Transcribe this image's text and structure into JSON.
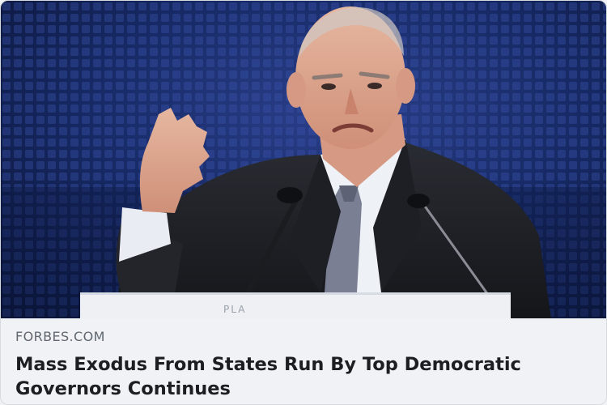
{
  "link_preview": {
    "domain": "FORBES.COM",
    "headline": "Mass Exodus From States Run By Top Democratic Governors Continues",
    "image_description_icon": "speaker-photo",
    "podium_text": "PLA"
  },
  "colors": {
    "footer_bg": "#f0f2f5",
    "domain_text": "#606770",
    "headline_text": "#1c1e21",
    "stage_bg": "#0d1a3a"
  }
}
